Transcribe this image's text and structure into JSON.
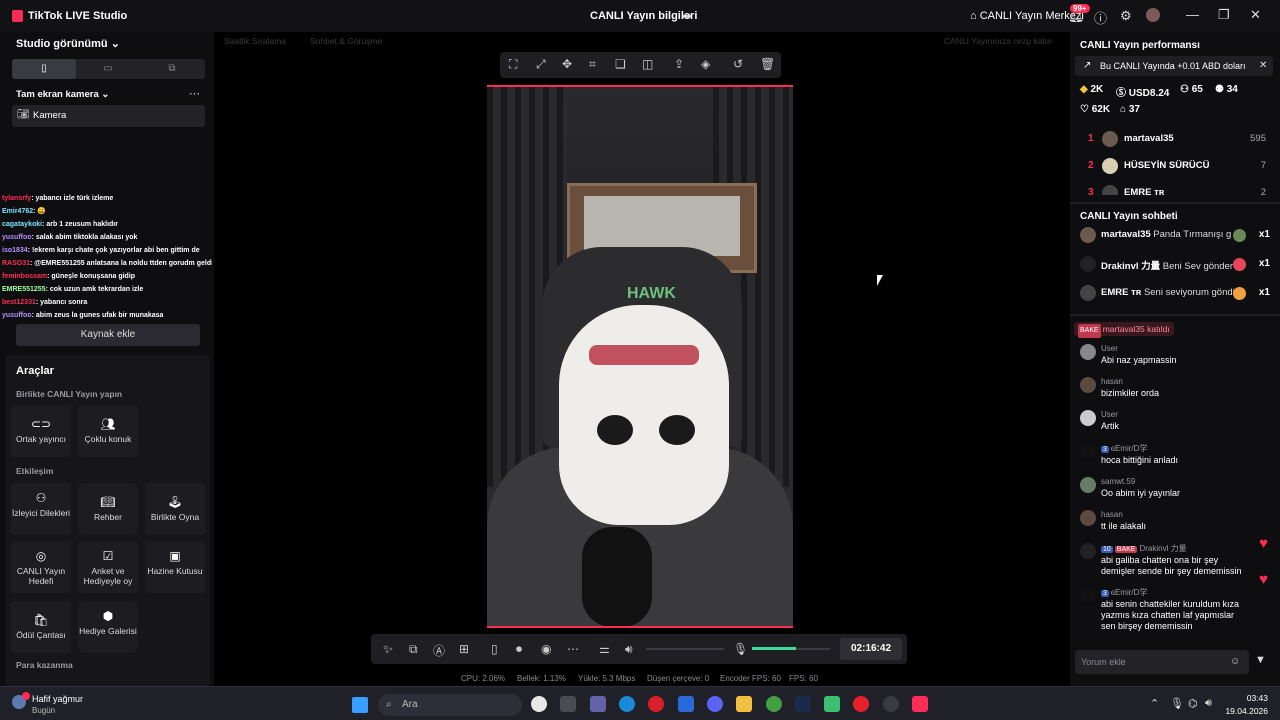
{
  "titlebar": {
    "app_name": "TikTok LIVE Studio",
    "center_title": "CANLI Yayın bilgileri",
    "live_center": "CANLI Yayın Merkezi",
    "notif_badge": "99+"
  },
  "left": {
    "studio_view": "Studio görünümü",
    "camera_section": "Tam ekran kamera",
    "camera_item": "Kamera",
    "add_source": "Kaynak ekle",
    "overlay_chat": [
      {
        "name": "tylansrfy",
        "text": "yabancı izle türk izleme",
        "color": "#fe2c55"
      },
      {
        "name": "Emir4762",
        "text": "😀",
        "color": "#7ee0ff"
      },
      {
        "name": "cagataykoki",
        "text": "arb 1 zeusum haklıdır",
        "color": "#7ee0ff"
      },
      {
        "name": "yusuffoo",
        "text": "salak abim tiktokla alakası yok",
        "color": "#b58cff"
      },
      {
        "name": "iso1834",
        "text": "!ekrem karşı chate çok yazıyorlar abi ben gittim de",
        "color": "#b58cff"
      },
      {
        "name": "RASO31",
        "text": "@EMRE551255 anlatsana la noldu ttden gorudm geldim",
        "color": "#fe2c55"
      },
      {
        "name": "feminbossam",
        "text": "güneşle konuşsana gidip",
        "color": "#fe2c55"
      },
      {
        "name": "EMRE551255",
        "text": "cok uzun amk tekrardan izle",
        "color": "#9bffa0"
      },
      {
        "name": "best12331",
        "text": "yabancı sonra",
        "color": "#fe2c55"
      },
      {
        "name": "yusuffoo",
        "text": "abim zeus la gunes ufak bir munakasa",
        "color": "#b58cff"
      }
    ],
    "tools_title": "Araçlar",
    "together_label": "Birlikte CANLI Yayın yapın",
    "tools_together": [
      "Ortak yayıncı",
      "Çoklu konuk"
    ],
    "interaction_label": "Etkileşim",
    "tools_interaction": [
      "İzleyici Dilekleri",
      "Rehber",
      "Birlikte Oyna",
      "CANLI Yayın Hedefi",
      "Anket ve Hediyeyle oy",
      "Hazine Kutusu",
      "Ödül Çantası",
      "Hediye Galerisi"
    ],
    "money_label": "Para kazanma"
  },
  "stage": {
    "faded_1": "Saatlik Sıralama",
    "faded_2": "Sohbet & Görüşme",
    "faded_3": "CANLI Yayınınıza cezp katın",
    "timer": "02:16:42",
    "hawk_text": "HAWK",
    "stats": {
      "cpu": "CPU: 2.06%",
      "memory": "Bellek: 1.13%",
      "upload": "Yükle: 5.3 Mbps",
      "dropped": "Düşen çerçeve: 0",
      "encoder": "Encoder FPS: 60",
      "fps": "FPS: 60"
    }
  },
  "right": {
    "perf_title": "CANLI Yayın performansı",
    "notice": "Bu CANLI Yayında +0.01 ABD doları",
    "stats": {
      "diamonds": "2K",
      "usd": "USD8.24",
      "viewers": "65",
      "followers": "34",
      "likes": "62K",
      "gifts": "37"
    },
    "ranking": [
      {
        "rank": "1",
        "name": "martaval35",
        "value": "595"
      },
      {
        "rank": "2",
        "name": "HÜSEYİN SÜRÜCÜ",
        "value": "7"
      },
      {
        "rank": "3",
        "name": "EMRE ᴛʀ",
        "value": "2"
      }
    ],
    "chat_title": "CANLI Yayın sohbeti",
    "gifts": [
      {
        "name": "martaval35",
        "text": "Panda Tırmanışı g",
        "count": "x1"
      },
      {
        "name": "Drakinvl 力量",
        "text": "Beni Sev gönder",
        "count": "x1"
      },
      {
        "name": "EMRE ᴛʀ",
        "text": "Seni seviyorum göndi",
        "count": "x1"
      }
    ],
    "joined_badge": "BAKE",
    "joined_text": "martaval35 katıldı",
    "comments": [
      {
        "user": "User",
        "text": "Abi naz yapmassin"
      },
      {
        "user": "hasan",
        "text": "bizimkiler orda"
      },
      {
        "user": "User",
        "text": "Artik"
      },
      {
        "user": "ɞEmir/D学",
        "level": "3",
        "text": "hoca bittiğini anladı"
      },
      {
        "user": "samwt.59",
        "text": "Oo abim iyi yayınlar"
      },
      {
        "user": "hasan",
        "text": "tt ile alakalı"
      },
      {
        "user": "Drakinvl 力量",
        "level": "10",
        "badge": "BAKE",
        "text": "abi galiba chatten ona bir şey demişler sende bir şey dememissin"
      },
      {
        "user": "ɞEmir/D学",
        "level": "3",
        "text": "abi senin chattekiler kuruldum kıza yazmıs kıza chatten laf yapmıslar sen birşey dememissin"
      }
    ],
    "comment_placeholder": "Yorum ekle"
  },
  "taskbar": {
    "weather_title": "Hafif yağmur",
    "weather_sub": "Bugün",
    "search_placeholder": "Ara",
    "time": "03:43",
    "date": "19.04.2026"
  }
}
